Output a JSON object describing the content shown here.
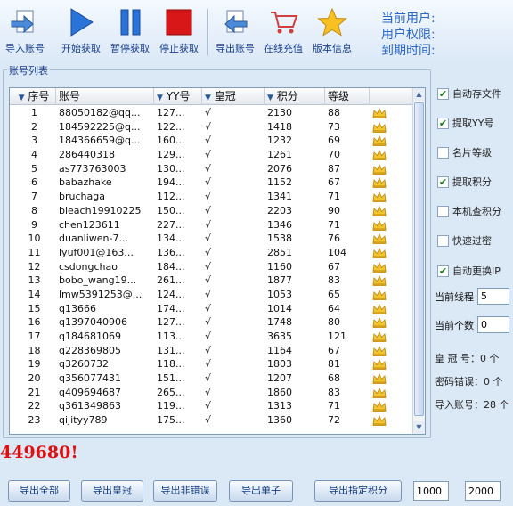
{
  "toolbar": {
    "import": "导入账号",
    "start": "开始获取",
    "pause": "暂停获取",
    "stop": "停止获取",
    "export": "导出账号",
    "recharge": "在线充值",
    "version": "版本信息"
  },
  "userinfo": {
    "current_user": "当前用户:",
    "permission": "用户权限:",
    "expiry": "到期时间:"
  },
  "list": {
    "group_title": "账号列表",
    "columns": [
      "序号",
      "账号",
      "YY号",
      "皇冠",
      "积分",
      "等级"
    ],
    "rows": [
      {
        "n": "1",
        "acct": "88050182@qq...",
        "yy": "127...",
        "crown": "√",
        "score": "2130",
        "level": "88"
      },
      {
        "n": "2",
        "acct": "184592225@q...",
        "yy": "122...",
        "crown": "√",
        "score": "1418",
        "level": "73"
      },
      {
        "n": "3",
        "acct": "184366659@q...",
        "yy": "160...",
        "crown": "√",
        "score": "1232",
        "level": "69"
      },
      {
        "n": "4",
        "acct": "286440318",
        "yy": "129...",
        "crown": "√",
        "score": "1261",
        "level": "70"
      },
      {
        "n": "5",
        "acct": "as773763003",
        "yy": "130...",
        "crown": "√",
        "score": "2076",
        "level": "87"
      },
      {
        "n": "6",
        "acct": "babazhake",
        "yy": "194...",
        "crown": "√",
        "score": "1152",
        "level": "67"
      },
      {
        "n": "7",
        "acct": "bruchaga",
        "yy": "112...",
        "crown": "√",
        "score": "1341",
        "level": "71"
      },
      {
        "n": "8",
        "acct": "bleach19910225",
        "yy": "150...",
        "crown": "√",
        "score": "2203",
        "level": "90"
      },
      {
        "n": "9",
        "acct": "chen123611",
        "yy": "227...",
        "crown": "√",
        "score": "1346",
        "level": "71"
      },
      {
        "n": "10",
        "acct": "duanliwen-7...",
        "yy": "134...",
        "crown": "√",
        "score": "1538",
        "level": "76"
      },
      {
        "n": "11",
        "acct": "lyuf001@163...",
        "yy": "136...",
        "crown": "√",
        "score": "2851",
        "level": "104"
      },
      {
        "n": "12",
        "acct": "csdongchao",
        "yy": "184...",
        "crown": "√",
        "score": "1160",
        "level": "67"
      },
      {
        "n": "13",
        "acct": "bobo_wang19...",
        "yy": "261...",
        "crown": "√",
        "score": "1877",
        "level": "83"
      },
      {
        "n": "14",
        "acct": "lmw5391253@...",
        "yy": "124...",
        "crown": "√",
        "score": "1053",
        "level": "65"
      },
      {
        "n": "15",
        "acct": "q13666",
        "yy": "174...",
        "crown": "√",
        "score": "1014",
        "level": "64"
      },
      {
        "n": "16",
        "acct": "q1397040906",
        "yy": "127...",
        "crown": "√",
        "score": "1748",
        "level": "80"
      },
      {
        "n": "17",
        "acct": "q184681069",
        "yy": "113...",
        "crown": "√",
        "score": "3635",
        "level": "121"
      },
      {
        "n": "18",
        "acct": "q228369805",
        "yy": "131...",
        "crown": "√",
        "score": "1164",
        "level": "67"
      },
      {
        "n": "19",
        "acct": "q3260732",
        "yy": "118...",
        "crown": "√",
        "score": "1803",
        "level": "81"
      },
      {
        "n": "20",
        "acct": "q356077431",
        "yy": "151...",
        "crown": "√",
        "score": "1207",
        "level": "68"
      },
      {
        "n": "21",
        "acct": "q409694687",
        "yy": "265...",
        "crown": "√",
        "score": "1860",
        "level": "83"
      },
      {
        "n": "22",
        "acct": "q361349863",
        "yy": "119...",
        "crown": "√",
        "score": "1313",
        "level": "71"
      },
      {
        "n": "23",
        "acct": "qijityy789",
        "yy": "175...",
        "crown": "√",
        "score": "1360",
        "level": "72"
      }
    ]
  },
  "options": [
    {
      "label": "自动存文件",
      "checked": true
    },
    {
      "label": "提取YY号",
      "checked": true
    },
    {
      "label": "名片等级",
      "checked": false
    },
    {
      "label": "提取积分",
      "checked": true
    },
    {
      "label": "本机查积分",
      "checked": false
    },
    {
      "label": "快速过密",
      "checked": false
    },
    {
      "label": "自动更换IP",
      "checked": true
    }
  ],
  "threads": {
    "label": "当前线程",
    "value": "5"
  },
  "count": {
    "label": "当前个数",
    "value": "0"
  },
  "stats": {
    "crown": "皇 冠 号：0 个",
    "pwd_error": "密码错误：0 个",
    "imported": "导入账号：28 个"
  },
  "big_number": "449680!",
  "bottom": {
    "export_all": "导出全部",
    "export_crown": "导出皇冠",
    "export_nonerror": "导出非错误",
    "export_single": "导出单子",
    "export_score": "导出指定积分",
    "min_score": "1000",
    "max_score": "2000"
  },
  "colors": {
    "accent": "#2b66c6",
    "alert": "#e01010",
    "check": "#1a7a1a",
    "crown": "#e8b820"
  }
}
